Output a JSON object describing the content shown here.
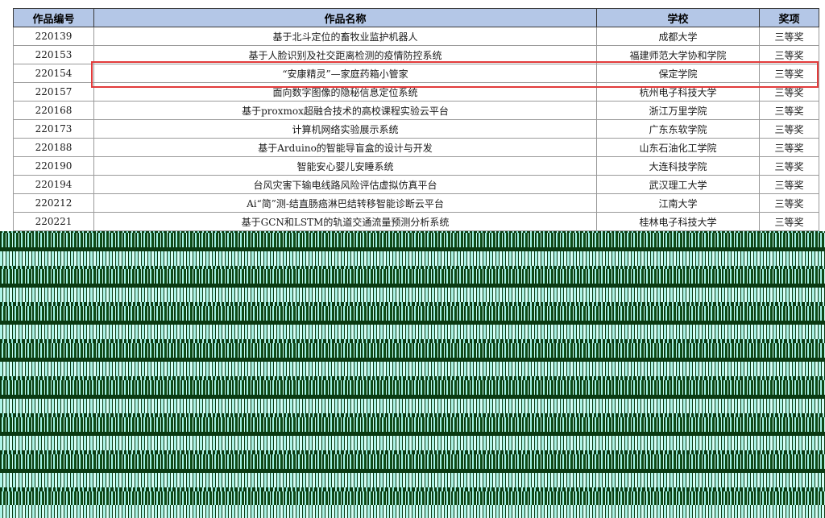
{
  "table": {
    "headers": {
      "id": "作品编号",
      "name": "作品名称",
      "school": "学校",
      "award": "奖项"
    },
    "rows": [
      {
        "id": "220139",
        "name": "基于北斗定位的畜牧业监护机器人",
        "school": "成都大学",
        "award": "三等奖"
      },
      {
        "id": "220153",
        "name": "基于人脸识别及社交距离检测的疫情防控系统",
        "school": "福建师范大学协和学院",
        "award": "三等奖"
      },
      {
        "id": "220154",
        "name": "“安康精灵”—家庭药箱小管家",
        "school": "保定学院",
        "award": "三等奖"
      },
      {
        "id": "220157",
        "name": "面向数字图像的隐秘信息定位系统",
        "school": "杭州电子科技大学",
        "award": "三等奖"
      },
      {
        "id": "220168",
        "name": "基于proxmox超融合技术的高校课程实验云平台",
        "school": "浙江万里学院",
        "award": "三等奖"
      },
      {
        "id": "220173",
        "name": "计算机网络实验展示系统",
        "school": "广东东软学院",
        "award": "三等奖"
      },
      {
        "id": "220188",
        "name": "基于Arduino的智能导盲盒的设计与开发",
        "school": "山东石油化工学院",
        "award": "三等奖"
      },
      {
        "id": "220190",
        "name": "智能安心婴儿安睡系统",
        "school": "大连科技学院",
        "award": "三等奖"
      },
      {
        "id": "220194",
        "name": "台风灾害下输电线路风险评估虚拟仿真平台",
        "school": "武汉理工大学",
        "award": "三等奖"
      },
      {
        "id": "220212",
        "name": "Ai“简”测-结直肠癌淋巴结转移智能诊断云平台",
        "school": "江南大学",
        "award": "三等奖"
      },
      {
        "id": "220221",
        "name": "基于GCN和LSTM的轨道交通流量预测分析系统",
        "school": "桂林电子科技大学",
        "award": "三等奖"
      }
    ]
  },
  "highlight": {
    "row_id": "220154",
    "color": "#e23b3b"
  },
  "colors": {
    "header_bg": "#b4c7e7",
    "corruption_dark": "#0a3a12",
    "corruption_light": "#9ff0e2"
  }
}
